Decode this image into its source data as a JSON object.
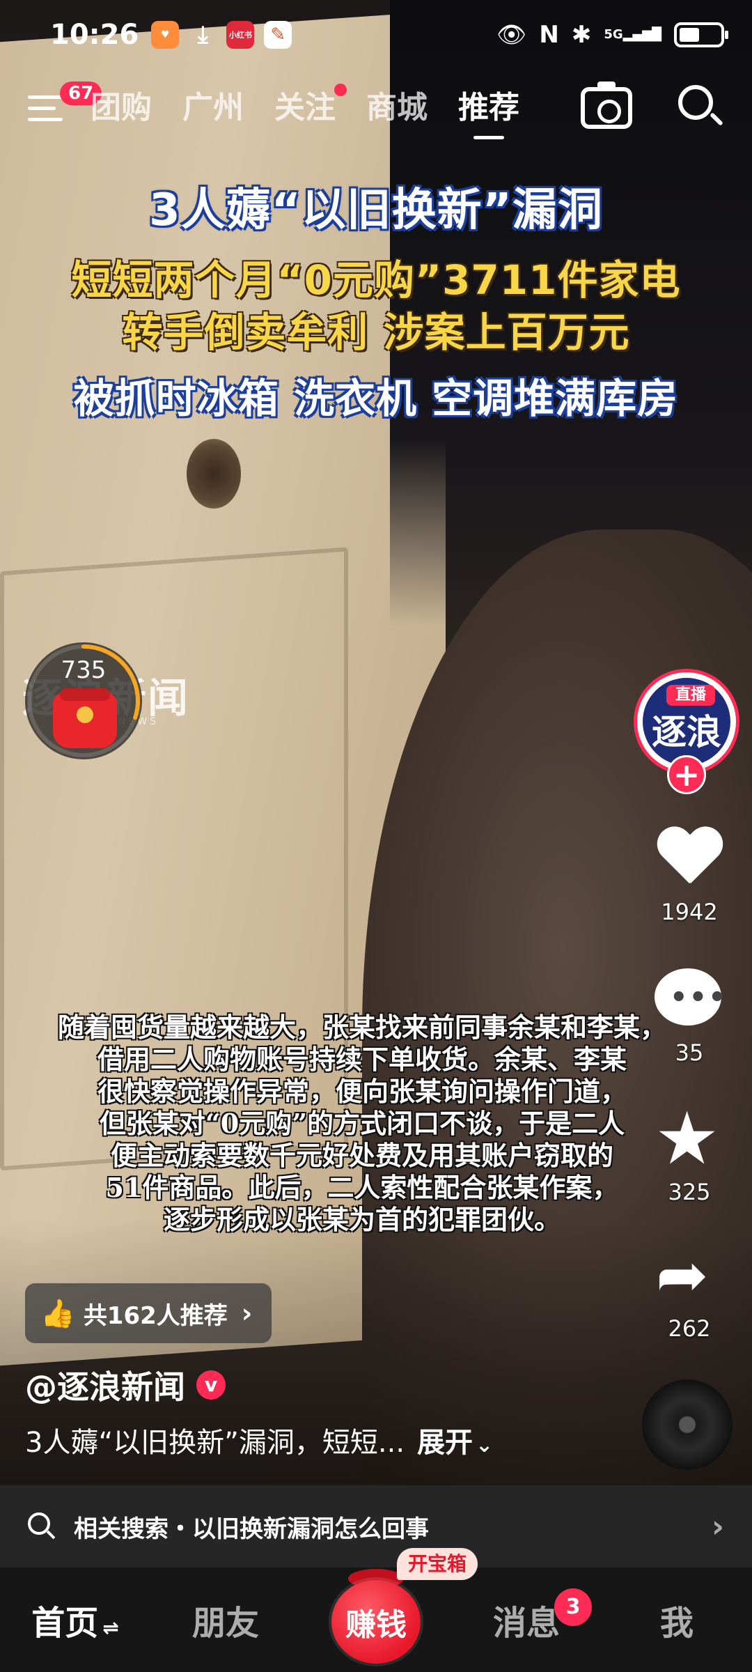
{
  "status_bar": {
    "time": "10:26",
    "network": "5G",
    "app_c_label": "小红书",
    "battery_level": 0.5
  },
  "top_nav": {
    "menu_badge": "67",
    "tabs": [
      {
        "label": "团购",
        "active": false
      },
      {
        "label": "广州",
        "active": false
      },
      {
        "label": "关注",
        "active": false,
        "dot": true
      },
      {
        "label": "商城",
        "active": false
      },
      {
        "label": "推荐",
        "active": true
      }
    ]
  },
  "video": {
    "headline_1": "3人薅“以旧换新”漏洞",
    "headline_2": "短短两个月“0元购”3711件家电",
    "headline_3": "转手倒卖牟利 涉案上百万元",
    "headline_4": "被抓时冰箱 洗衣机 空调堆满库房",
    "watermark": "逐浪新闻",
    "watermark_sub": "NEWS",
    "subtitle_lines": [
      "随着囤货量越来越大，张某找来前同事余某和李某，",
      "借用二人购物账号持续下单收货。余某、李某",
      "很快察觉操作异常，便向张某询问操作门道，",
      "但张某对“0元购”的方式闭口不谈，于是二人",
      "便主动索要数千元好处费及用其账户窃取的",
      "51件商品。此后，二人索性配合张某作案，",
      "逐步形成以张某为首的犯罪团伙。"
    ]
  },
  "red_packet": {
    "count": "735",
    "progress": 0.3
  },
  "right_rail": {
    "author_avatar_text": "逐浪",
    "live_label": "直播",
    "follow_symbol": "+",
    "likes": "1942",
    "comments": "35",
    "favorites": "325",
    "shares": "262"
  },
  "info": {
    "recommend_text": "共162人推荐",
    "author": "@逐浪新闻",
    "verified_symbol": "v",
    "caption": "3人薅“以旧换新”漏洞，短短...",
    "expand": "展开"
  },
  "related_search": {
    "text": "相关搜索・以旧换新漏洞怎么回事"
  },
  "tab_bar": {
    "home": "首页",
    "friends": "朋友",
    "earn": "赚钱",
    "treasure_tag": "开宝箱",
    "messages": "消息",
    "messages_badge": "3",
    "me": "我"
  },
  "colors": {
    "accent": "#fe2c55",
    "headline_yellow": "#f8d648",
    "headline_outline_blue": "#1c3f9c"
  },
  "icons": [
    "menu-icon",
    "camera-icon",
    "search-icon",
    "heart-icon",
    "comment-icon",
    "star-icon",
    "share-icon",
    "music-disc-icon",
    "thumb-up-icon",
    "red-packet-icon"
  ]
}
